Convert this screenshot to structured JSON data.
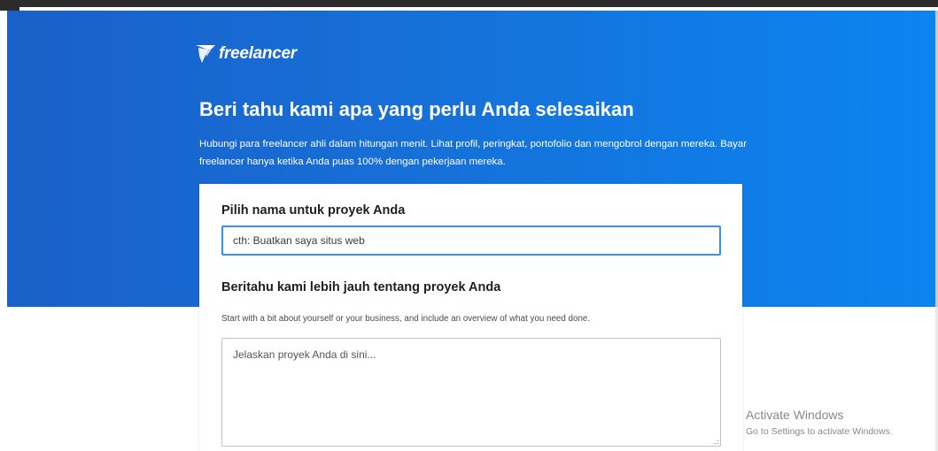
{
  "brand": {
    "name": "freelancer",
    "logo_icon": "freelancer-bird-icon",
    "colors": {
      "hero_start": "#1a60c9",
      "hero_end": "#0b84f0",
      "input_focus": "#3792e6"
    }
  },
  "hero": {
    "title": "Beri tahu kami apa yang perlu Anda selesaikan",
    "description": "Hubungi para freelancer ahli dalam hitungan menit. Lihat profil, peringkat, portofolio dan mengobrol dengan mereka. Bayar freelancer hanya ketika Anda puas 100% dengan pekerjaan mereka."
  },
  "form": {
    "project_name": {
      "label": "Pilih nama untuk proyek Anda",
      "placeholder": "cth: Buatkan saya situs web",
      "value": ""
    },
    "project_description": {
      "label": "Beritahu kami lebih jauh tentang proyek Anda",
      "helper": "Start with a bit about yourself or your business, and include an overview of what you need done.",
      "placeholder": "Jelaskan proyek Anda di sini...",
      "value": ""
    }
  },
  "os_watermark": {
    "title": "Activate Windows",
    "subtitle": "Go to Settings to activate Windows."
  }
}
